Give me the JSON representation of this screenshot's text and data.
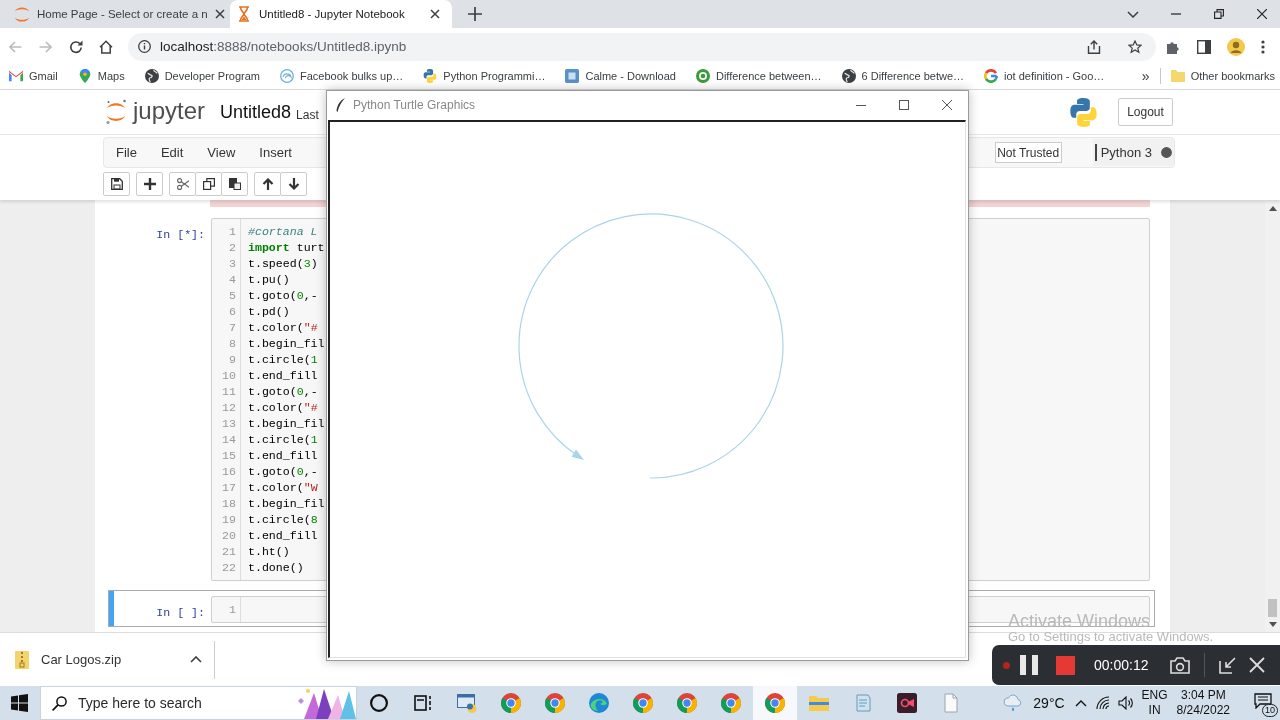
{
  "browser": {
    "tabs": [
      {
        "title": "Home Page - Select or create a n",
        "selected": false
      },
      {
        "title": "Untitled8 - Jupyter Notebook",
        "selected": true
      }
    ],
    "address": {
      "host": "localhost",
      "path": ":8888/notebooks/Untitled8.ipynb"
    },
    "bookmarks": [
      "Gmail",
      "Maps",
      "Developer Program",
      "Facebook bulks up…",
      "Python Programmi…",
      "Calme - Download",
      "Difference between…",
      "6 Difference betwe…",
      "iot definition - Goo…"
    ],
    "more_bookmarks": "»",
    "other_bookmarks": "Other bookmarks"
  },
  "notebook": {
    "logo_text": "jupyter",
    "name": "Untitled8",
    "checkpoint": "Last",
    "logout": "Logout",
    "menu": [
      "File",
      "Edit",
      "View",
      "Insert"
    ],
    "trust": "Not Trusted",
    "kernel": {
      "name": "Python 3",
      "busy": true
    },
    "cells": [
      {
        "prompt": "In [*]:",
        "selected": false,
        "lines": [
          {
            "number": "1",
            "tokens": [
              {
                "kind": "comment",
                "text": "#cortana L"
              }
            ]
          },
          {
            "number": "2",
            "tokens": [
              {
                "kind": "keyword",
                "text": "import"
              },
              {
                "kind": "plain",
                "text": " turt"
              }
            ]
          },
          {
            "number": "3",
            "tokens": [
              {
                "kind": "plain",
                "text": "t.speed("
              },
              {
                "kind": "number",
                "text": "3"
              },
              {
                "kind": "plain",
                "text": ")"
              }
            ]
          },
          {
            "number": "4",
            "tokens": [
              {
                "kind": "plain",
                "text": "t.pu()"
              }
            ]
          },
          {
            "number": "5",
            "tokens": [
              {
                "kind": "plain",
                "text": "t.goto("
              },
              {
                "kind": "number",
                "text": "0"
              },
              {
                "kind": "plain",
                "text": ",-"
              }
            ]
          },
          {
            "number": "6",
            "tokens": [
              {
                "kind": "plain",
                "text": "t.pd()"
              }
            ]
          },
          {
            "number": "7",
            "tokens": [
              {
                "kind": "plain",
                "text": "t.color("
              },
              {
                "kind": "string",
                "text": "\"#"
              }
            ]
          },
          {
            "number": "8",
            "tokens": [
              {
                "kind": "plain",
                "text": "t.begin_fil"
              }
            ]
          },
          {
            "number": "9",
            "tokens": [
              {
                "kind": "plain",
                "text": "t.circle("
              },
              {
                "kind": "number",
                "text": "1"
              }
            ]
          },
          {
            "number": "10",
            "tokens": [
              {
                "kind": "plain",
                "text": "t.end_fill"
              }
            ]
          },
          {
            "number": "11",
            "tokens": [
              {
                "kind": "plain",
                "text": "t.goto("
              },
              {
                "kind": "number",
                "text": "0"
              },
              {
                "kind": "plain",
                "text": ",-"
              }
            ]
          },
          {
            "number": "12",
            "tokens": [
              {
                "kind": "plain",
                "text": "t.color("
              },
              {
                "kind": "string",
                "text": "\"#"
              }
            ]
          },
          {
            "number": "13",
            "tokens": [
              {
                "kind": "plain",
                "text": "t.begin_fil"
              }
            ]
          },
          {
            "number": "14",
            "tokens": [
              {
                "kind": "plain",
                "text": "t.circle("
              },
              {
                "kind": "number",
                "text": "1"
              }
            ]
          },
          {
            "number": "15",
            "tokens": [
              {
                "kind": "plain",
                "text": "t.end_fill"
              }
            ]
          },
          {
            "number": "16",
            "tokens": [
              {
                "kind": "plain",
                "text": "t.goto("
              },
              {
                "kind": "number",
                "text": "0"
              },
              {
                "kind": "plain",
                "text": ",-"
              }
            ]
          },
          {
            "number": "17",
            "tokens": [
              {
                "kind": "plain",
                "text": "t.color("
              },
              {
                "kind": "string",
                "text": "\"W"
              }
            ]
          },
          {
            "number": "18",
            "tokens": [
              {
                "kind": "plain",
                "text": "t.begin_fil"
              }
            ]
          },
          {
            "number": "19",
            "tokens": [
              {
                "kind": "plain",
                "text": "t.circle("
              },
              {
                "kind": "number",
                "text": "8"
              }
            ]
          },
          {
            "number": "20",
            "tokens": [
              {
                "kind": "plain",
                "text": "t.end_fill"
              }
            ]
          },
          {
            "number": "21",
            "tokens": [
              {
                "kind": "plain",
                "text": "t.ht()"
              }
            ]
          },
          {
            "number": "22",
            "tokens": [
              {
                "kind": "plain",
                "text": "t.done()"
              }
            ]
          }
        ]
      },
      {
        "prompt": "In [ ]:",
        "selected": true,
        "lines": [
          {
            "number": "1"
          }
        ]
      }
    ]
  },
  "turtle_window": {
    "title": "Python Turtle Graphics"
  },
  "activation": {
    "title": "Activate Windows",
    "hint": "Go to Settings to activate Windows."
  },
  "recorder": {
    "time": "00:00:12"
  },
  "downloads": [
    {
      "name": "Car Logos.zip"
    }
  ],
  "taskbar": {
    "search": {
      "placeholder": "Type here to search"
    },
    "apps": [
      {
        "kind": "ring",
        "selected": false
      },
      {
        "kind": "taskview",
        "selected": false
      },
      {
        "kind": "editor",
        "selected": false
      },
      {
        "kind": "browser",
        "selected": false
      },
      {
        "kind": "browser",
        "selected": false
      },
      {
        "kind": "swirl",
        "selected": false
      },
      {
        "kind": "browser",
        "selected": false
      },
      {
        "kind": "browser",
        "selected": false
      },
      {
        "kind": "browser",
        "selected": false
      },
      {
        "kind": "browser",
        "selected": true
      },
      {
        "kind": "folder",
        "selected": false
      },
      {
        "kind": "notepad",
        "selected": false
      },
      {
        "kind": "camera",
        "selected": false
      },
      {
        "kind": "page",
        "selected": false
      }
    ],
    "weather": "29°C",
    "language": {
      "input": "ENG",
      "region": "IN"
    },
    "clock": {
      "time": "3:04 PM",
      "date": "8/24/2022"
    },
    "notifications": "10"
  }
}
